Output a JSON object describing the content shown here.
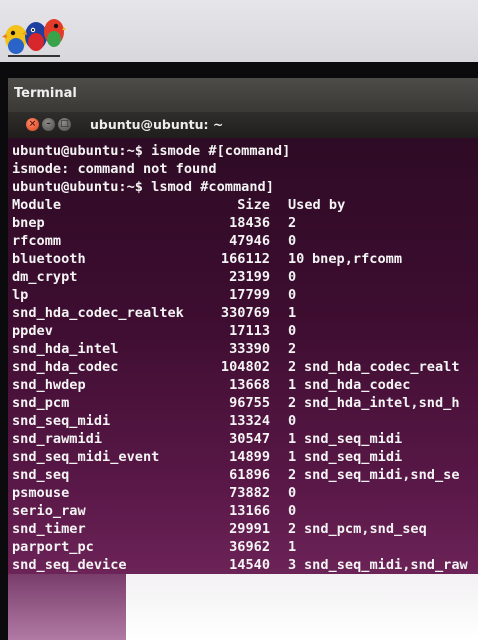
{
  "menubar": {
    "app_title": "Terminal"
  },
  "window": {
    "title": "ubuntu@ubuntu: ~",
    "close_glyph": "×",
    "min_glyph": "–",
    "max_glyph": "□"
  },
  "terminal": {
    "lines": [
      "ubuntu@ubuntu:~$ ismode #[command]",
      "ismode: command not found",
      "ubuntu@ubuntu:~$ lsmod #command]"
    ],
    "header": {
      "module": "Module",
      "size": "Size",
      "used_by": "Used by"
    },
    "modules": [
      {
        "name": "bnep",
        "size": "18436",
        "count": "2",
        "by": ""
      },
      {
        "name": "rfcomm",
        "size": "47946",
        "count": "0",
        "by": ""
      },
      {
        "name": "bluetooth",
        "size": "166112",
        "count": "10",
        "by": "bnep,rfcomm"
      },
      {
        "name": "dm_crypt",
        "size": "23199",
        "count": "0",
        "by": ""
      },
      {
        "name": "lp",
        "size": "17799",
        "count": "0",
        "by": ""
      },
      {
        "name": "snd_hda_codec_realtek",
        "size": "330769",
        "count": "1",
        "by": ""
      },
      {
        "name": "ppdev",
        "size": "17113",
        "count": "0",
        "by": ""
      },
      {
        "name": "snd_hda_intel",
        "size": "33390",
        "count": "2",
        "by": ""
      },
      {
        "name": "snd_hda_codec",
        "size": "104802",
        "count": "2",
        "by": "snd_hda_codec_realt"
      },
      {
        "name": "snd_hwdep",
        "size": "13668",
        "count": "1",
        "by": "snd_hda_codec"
      },
      {
        "name": "snd_pcm",
        "size": "96755",
        "count": "2",
        "by": "snd_hda_intel,snd_h"
      },
      {
        "name": "snd_seq_midi",
        "size": "13324",
        "count": "0",
        "by": ""
      },
      {
        "name": "snd_rawmidi",
        "size": "30547",
        "count": "1",
        "by": "snd_seq_midi"
      },
      {
        "name": "snd_seq_midi_event",
        "size": "14899",
        "count": "1",
        "by": "snd_seq_midi"
      },
      {
        "name": "snd_seq",
        "size": "61896",
        "count": "2",
        "by": "snd_seq_midi,snd_se"
      },
      {
        "name": "psmouse",
        "size": "73882",
        "count": "0",
        "by": ""
      },
      {
        "name": "serio_raw",
        "size": "13166",
        "count": "0",
        "by": ""
      },
      {
        "name": "snd_timer",
        "size": "29991",
        "count": "2",
        "by": "snd_pcm,snd_seq"
      },
      {
        "name": "parport_pc",
        "size": "36962",
        "count": "1",
        "by": ""
      },
      {
        "name": "snd_seq_device",
        "size": "14540",
        "count": "3",
        "by": "snd_seq_midi,snd_raw"
      }
    ]
  },
  "colors": {
    "terminal_bg": "#3d0d30",
    "terminal_text": "#f4f4f4",
    "close_button": "#d6421c"
  },
  "icons": {
    "logo": "birds-logo-icon",
    "close": "close-icon",
    "minimize": "minimize-icon",
    "maximize": "maximize-icon"
  }
}
